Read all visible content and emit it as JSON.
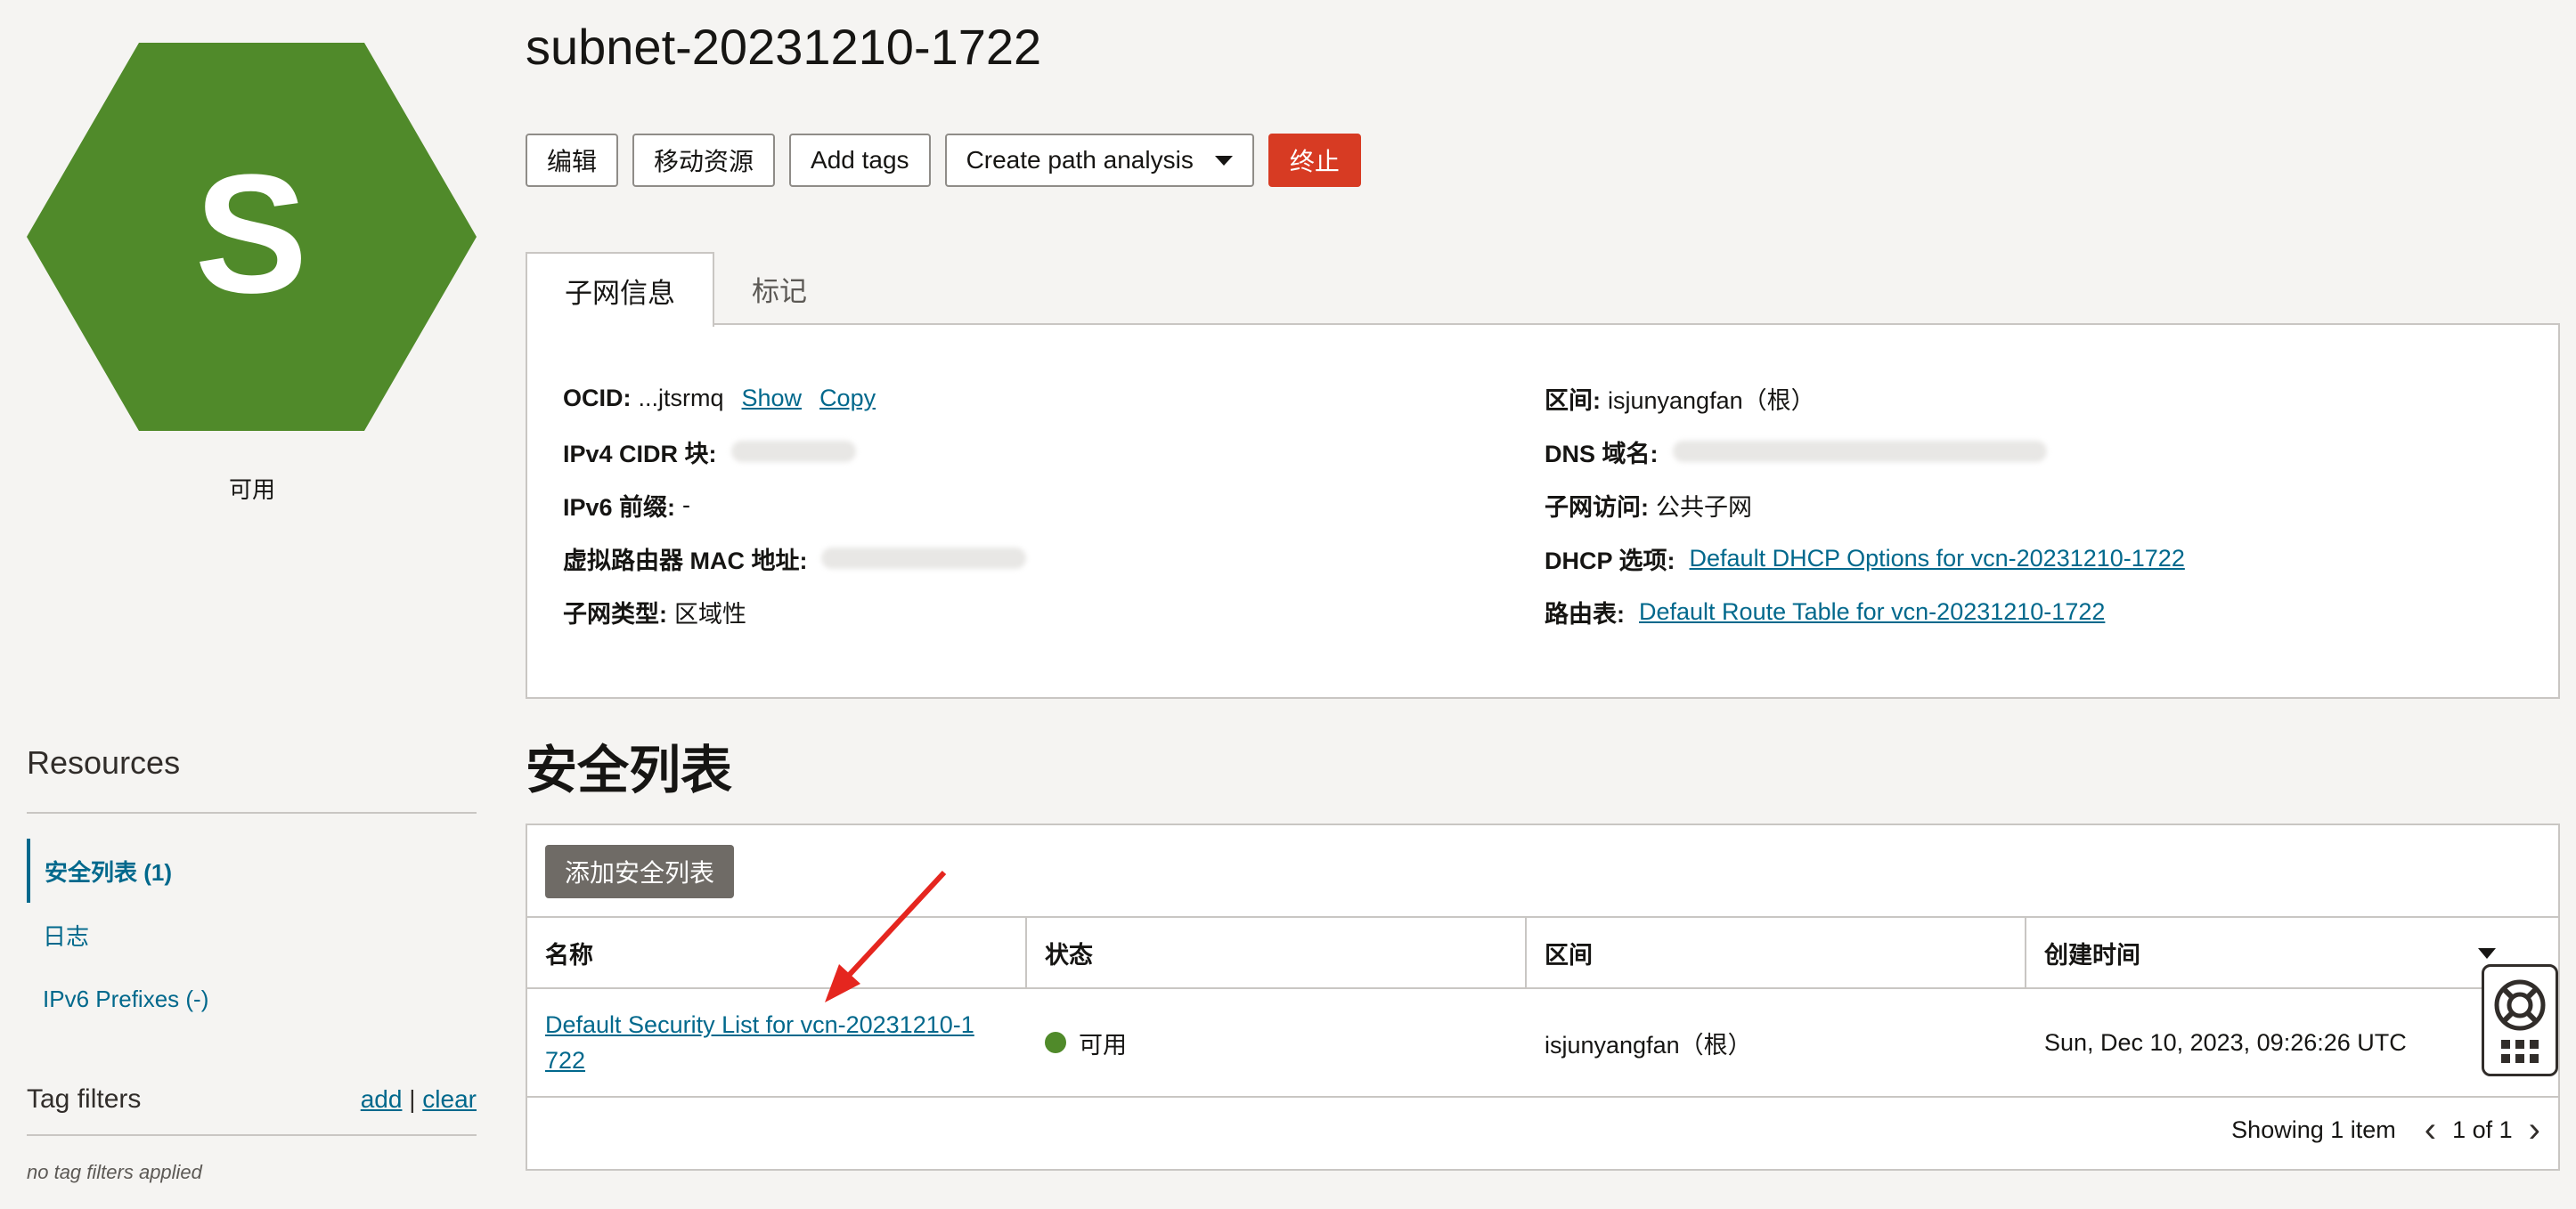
{
  "resource": {
    "letter": "S",
    "status": "可用",
    "hex_color": "#508a2a"
  },
  "page_title": "subnet-20231210-1722",
  "toolbar": {
    "edit": "编辑",
    "move": "移动资源",
    "add_tags": "Add tags",
    "path_analysis": "Create path analysis",
    "terminate": "终止"
  },
  "tabs": {
    "info": "子网信息",
    "tags": "标记"
  },
  "info": {
    "ocid_label": "OCID:",
    "ocid_value": "...jtsrmq",
    "show": "Show",
    "copy": "Copy",
    "ipv4_label": "IPv4 CIDR 块:",
    "ipv6_label": "IPv6 前缀:",
    "ipv6_value": "-",
    "mac_label": "虚拟路由器 MAC 地址:",
    "subnet_type_label": "子网类型:",
    "subnet_type_value": "区域性",
    "compartment_label": "区间:",
    "compartment_value": "isjunyangfan（根）",
    "dns_label": "DNS 域名:",
    "access_label": "子网访问:",
    "access_value": "公共子网",
    "dhcp_label": "DHCP 选项:",
    "dhcp_value": "Default DHCP Options for vcn-20231210-1722",
    "route_label": "路由表:",
    "route_value": "Default Route Table for vcn-20231210-1722"
  },
  "security_lists": {
    "title": "安全列表",
    "add_button": "添加安全列表",
    "columns": [
      "名称",
      "状态",
      "区间",
      "创建时间"
    ],
    "rows": [
      {
        "name_line1": "Default Security List for vcn-20231210-1",
        "name_line2": "722",
        "status": "可用",
        "compartment": "isjunyangfan（根）",
        "created": "Sun, Dec 10, 2023, 09:26:26 UTC"
      }
    ],
    "showing": "Showing 1 item",
    "page": "1 of 1"
  },
  "sidebar": {
    "resources_title": "Resources",
    "items": [
      {
        "label": "安全列表 (1)"
      },
      {
        "label": "日志"
      },
      {
        "label": "IPv6 Prefixes (-)"
      }
    ],
    "tag_filters_title": "Tag filters",
    "add": "add",
    "clear": "clear",
    "no_tag_filters": "no tag filters applied"
  },
  "colors": {
    "link": "#00688c",
    "danger": "#d73b23",
    "annotation_arrow": "#e5261f"
  }
}
